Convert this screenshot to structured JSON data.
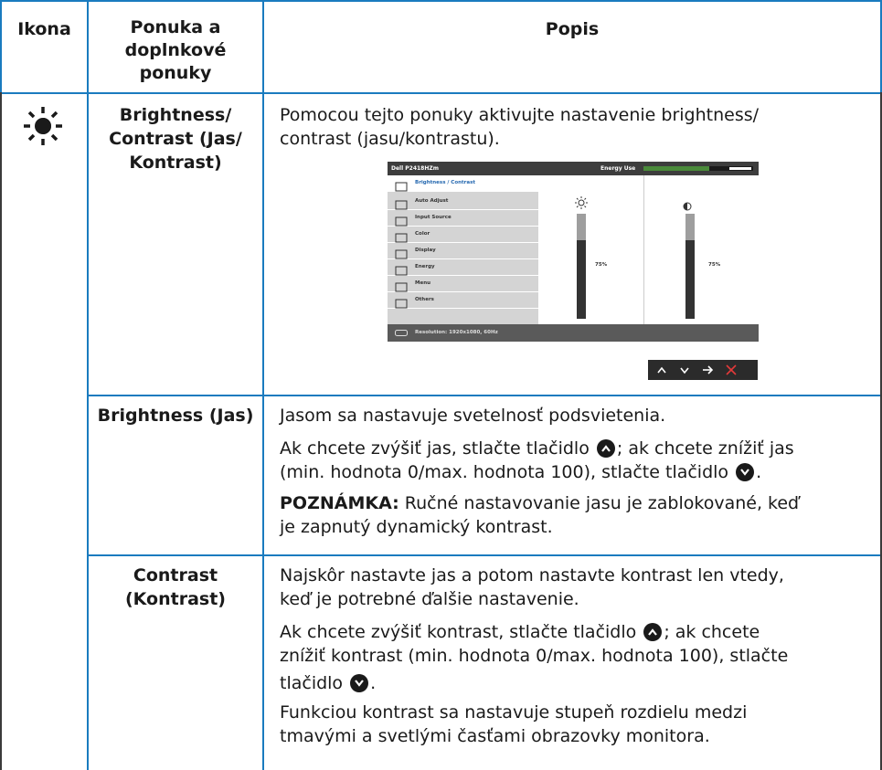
{
  "header": {
    "col1": "Ikona",
    "col2_line1": "Ponuka a",
    "col2_line2": "doplnkové",
    "col2_line3": "ponuky",
    "col3": "Popis"
  },
  "rows": {
    "brightness_contrast": {
      "icon": "brightness-icon",
      "menu_line1": "Brightness/",
      "menu_line2": "Contrast (Jas/",
      "menu_line3": "Kontrast)",
      "desc_line1": "Pomocou tejto ponuky aktivujte nastavenie brightness/",
      "desc_line2": "contrast (jasu/kontrastu)."
    },
    "brightness": {
      "menu": "Brightness (Jas)",
      "p1": "Jasom sa nastavuje svetelnosť podsvietenia.",
      "p2_line1_a": "Ak chcete zvýšiť jas, stlačte tlačidlo",
      "p2_line1_b": "; ak chcete znížiť jas",
      "p2_line2_a": "(min. hodnota 0/max. hodnota 100), stlačte tlačidlo",
      "p2_line2_b": ".",
      "note_label": "POZNÁMKA:",
      "note_line1": " Ručné nastavovanie jasu je zablokované, keď",
      "note_line2": "je zapnutý dynamický kontrast."
    },
    "contrast": {
      "menu_line1": "Contrast",
      "menu_line2": "(Kontrast)",
      "p1_line1": "Najskôr nastavte jas a potom nastavte kontrast len vtedy,",
      "p1_line2": "keď je potrebné ďalšie nastavenie.",
      "p2_line1_a": "Ak chcete zvýšiť kontrast, stlačte tlačidlo",
      "p2_line1_b": "; ak chcete",
      "p2_line2": "znížiť kontrast (min. hodnota 0/max. hodnota 100), stlačte",
      "p2_line3_a": "tlačidlo",
      "p2_line3_b": ".",
      "p3_line1": "Funkciou kontrast sa nastavuje stupeň rozdielu medzi",
      "p3_line2": "tmavými a svetlými časťami obrazovky monitora."
    }
  },
  "osd": {
    "model": "Dell P2418HZm",
    "energy_label": "Energy Use",
    "energy_level": 0.75,
    "menu_items": [
      "Brightness / Contrast",
      "Auto Adjust",
      "Input Source",
      "Color",
      "Display",
      "Energy",
      "Menu",
      "Others"
    ],
    "brightness_value": "75%",
    "contrast_value": "75%",
    "brightness_level": 0.75,
    "contrast_level": 0.75,
    "resolution": "Resolution: 1920x1080, 60Hz",
    "nav_buttons": [
      "up",
      "down",
      "right",
      "close"
    ]
  }
}
